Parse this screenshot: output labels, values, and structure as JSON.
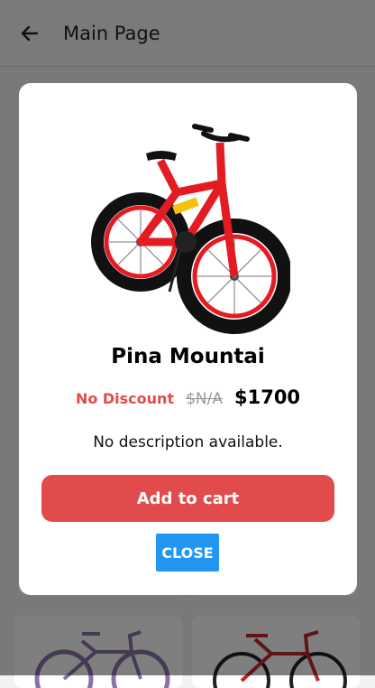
{
  "appbar": {
    "title": "Main Page",
    "back_icon": "arrow-left-icon"
  },
  "modal": {
    "product_image_icon": "bicycle-image",
    "product_name": "Pina Mountai",
    "discount_label": "No Discount",
    "original_price": "$N/A",
    "price": "$1700",
    "description": "No description available.",
    "add_to_cart_label": "Add to cart",
    "close_label": "CLOSE"
  },
  "colors": {
    "accent_red": "#e24b4b",
    "close_blue": "#2196f3",
    "overlay": "rgba(0,0,0,0.5)"
  }
}
